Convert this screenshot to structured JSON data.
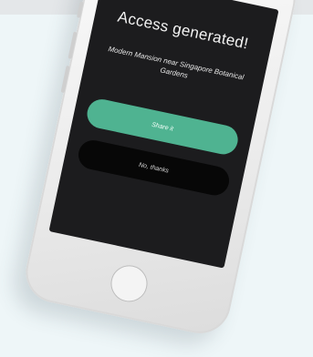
{
  "screen": {
    "title": "Access generated!",
    "subtitle": "Modern Mansion near Singapore Botanical Gardens",
    "primary_button_label": "Share it",
    "secondary_button_label": "No, thanks"
  },
  "colors": {
    "background": "#eef6f8",
    "screen": "#1c1c1e",
    "accent": "#4fb391",
    "secondary_button": "#070707"
  }
}
